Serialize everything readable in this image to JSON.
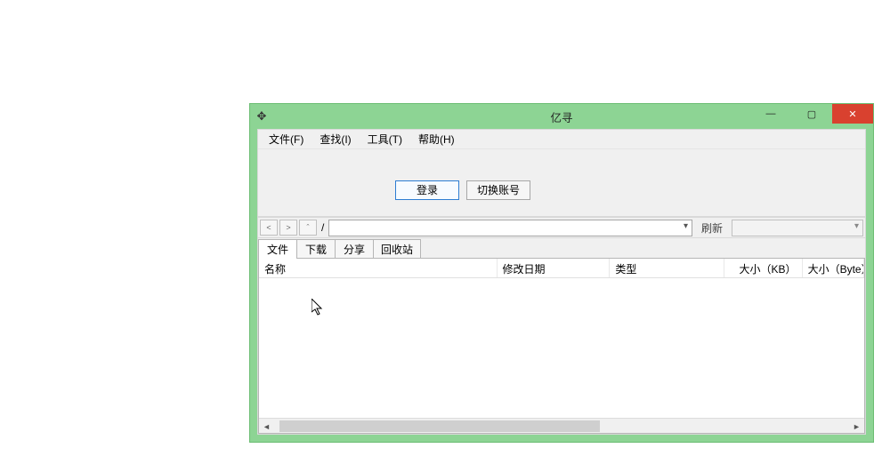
{
  "window": {
    "title": "亿寻",
    "app_icon": "✥",
    "controls": {
      "min": "—",
      "max": "▢",
      "close": "✕"
    }
  },
  "menu": {
    "file": "文件(F)",
    "find": "查找(I)",
    "tools": "工具(T)",
    "help": "帮助(H)"
  },
  "toolbar": {
    "login": "登录",
    "switch_account": "切换账号"
  },
  "nav": {
    "back": "<",
    "forward": ">",
    "up": "ˆ",
    "path_label": "/",
    "path_value": "",
    "refresh": "刷新",
    "search_value": ""
  },
  "tabs": {
    "files": "文件",
    "downloads": "下载",
    "share": "分享",
    "recycle": "回收站"
  },
  "columns": {
    "name": "名称",
    "modified": "修改日期",
    "type": "类型",
    "size_kb": "大小（KB）",
    "size_bytes": "大小（Byte）"
  },
  "column_widths": {
    "name": 270,
    "modified": 128,
    "type": 130,
    "size_kb": 88,
    "size_bytes": 70
  },
  "rows": []
}
